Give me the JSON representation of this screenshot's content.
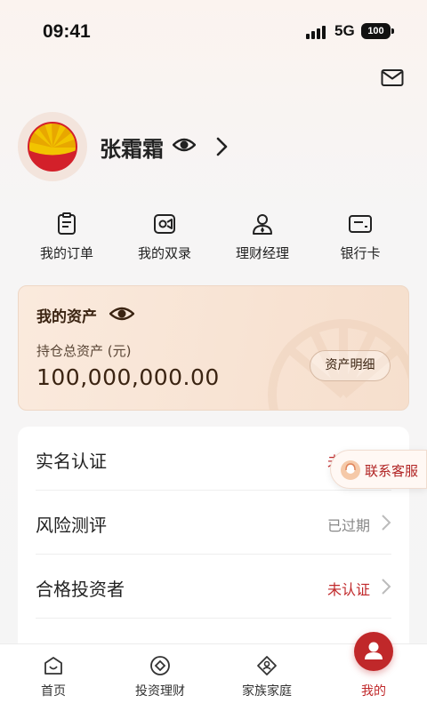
{
  "status_bar": {
    "time": "09:41",
    "network": "5G",
    "battery": "100"
  },
  "header": {
    "mail_icon": "mail-icon"
  },
  "profile": {
    "name": "张霜霜",
    "eye_icon": "eye-icon",
    "chevron": "chevron-right-icon"
  },
  "quick_actions": [
    {
      "label": "我的订单",
      "icon": "order-icon"
    },
    {
      "label": "我的双录",
      "icon": "video-record-icon"
    },
    {
      "label": "理财经理",
      "icon": "advisor-icon"
    },
    {
      "label": "银行卡",
      "icon": "bank-card-icon"
    }
  ],
  "assets": {
    "title": "我的资产",
    "subtitle": "持仓总资产 (元)",
    "amount": "100,000,000.00",
    "detail_button": "资产明细"
  },
  "settings_list": [
    {
      "label": "实名认证",
      "status": "未认证",
      "status_color": "#c0282a"
    },
    {
      "label": "风险测评",
      "status": "已过期",
      "status_color": "#888888"
    },
    {
      "label": "合格投资者",
      "status": "未认证",
      "status_color": "#c0282a"
    }
  ],
  "floating_service": {
    "label": "联系客服",
    "icon": "customer-service-icon"
  },
  "tab_bar": {
    "tabs": [
      {
        "label": "首页",
        "icon": "home-icon"
      },
      {
        "label": "投资理财",
        "icon": "invest-icon"
      },
      {
        "label": "家族家庭",
        "icon": "family-icon"
      },
      {
        "label": "我的",
        "icon": "profile-icon"
      }
    ],
    "active_index": 3
  },
  "colors": {
    "accent": "#c0282a",
    "card_bg": "#f8e3d3",
    "card_text": "#3b2412"
  }
}
